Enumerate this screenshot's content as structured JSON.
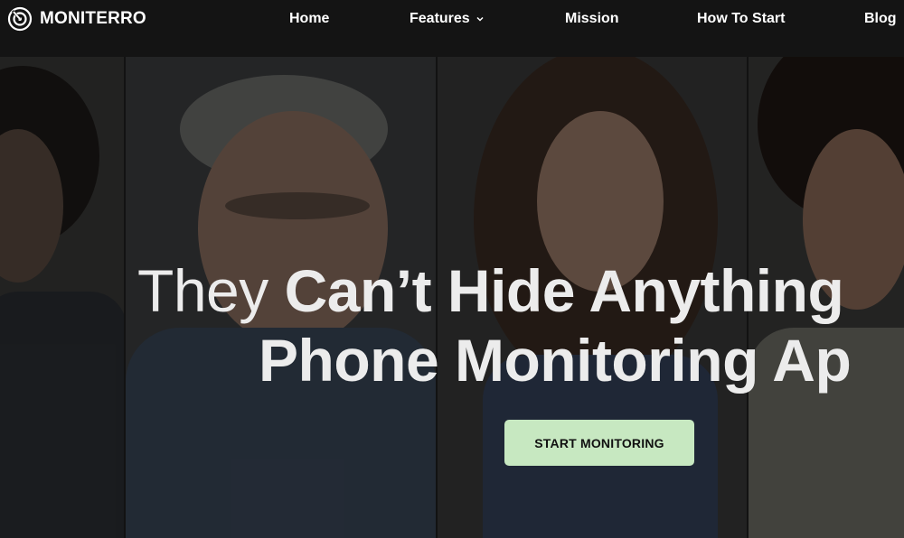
{
  "brand": {
    "name": "MONITERRO",
    "icon": "target-icon"
  },
  "nav": {
    "items": [
      {
        "label": "Home"
      },
      {
        "label": "Features",
        "icon": "chevron-down-icon"
      },
      {
        "label": "Mission"
      },
      {
        "label": "How To Start"
      },
      {
        "label": "Blog"
      }
    ]
  },
  "hero": {
    "line1_light": "They ",
    "line1_bold": "Can’t Hide Anything",
    "line2": "Phone Monitoring Ap",
    "cta_label": "START MONITORING"
  },
  "colors": {
    "nav_bg": "#141414",
    "cta_bg": "#c7e8c1",
    "headline": "#ececec"
  }
}
